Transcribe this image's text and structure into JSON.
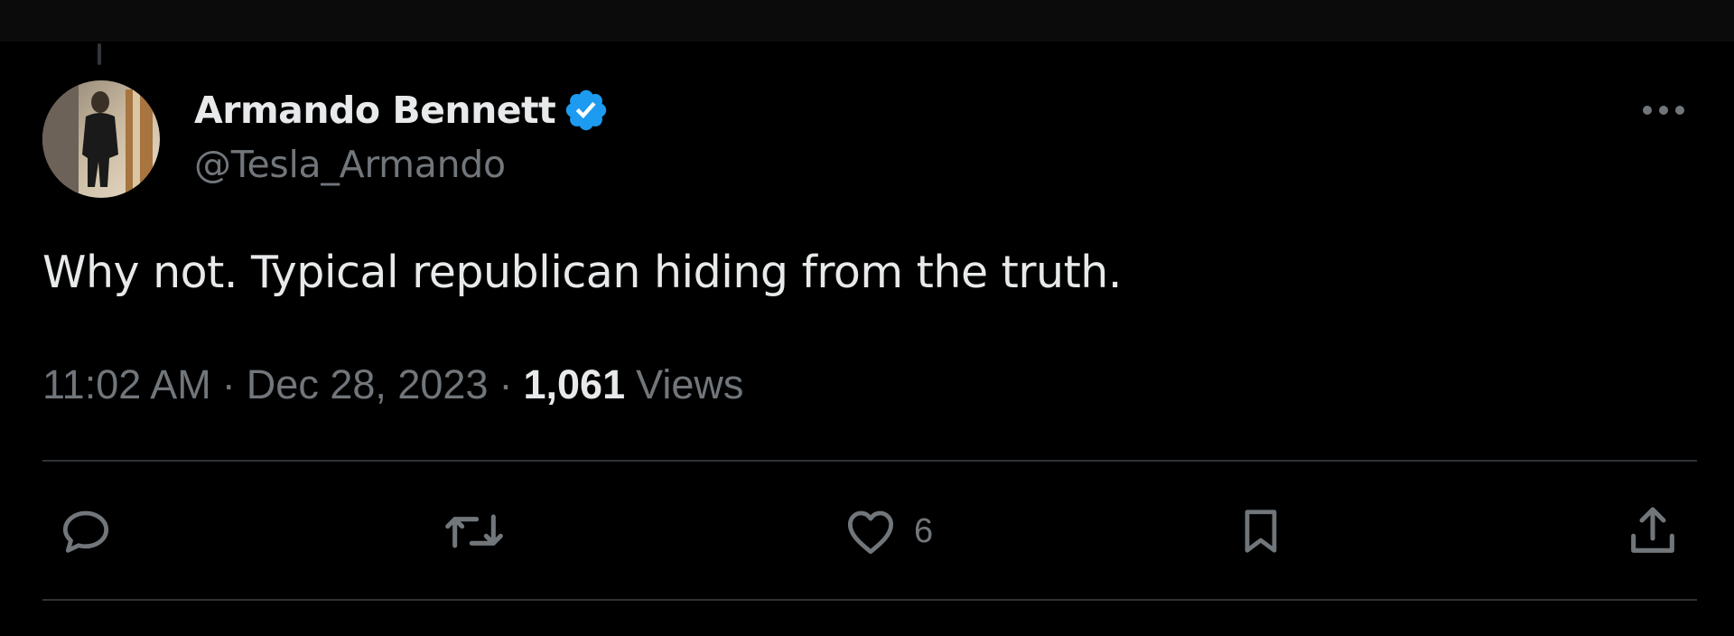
{
  "author": {
    "display_name": "Armando Bennett",
    "handle": "@Tesla_Armando",
    "verified": true
  },
  "tweet": {
    "text": "Why not. Typical republican hiding from the truth."
  },
  "meta": {
    "time": "11:02 AM",
    "separator": "·",
    "date": "Dec 28, 2023",
    "views_count": "1,061",
    "views_label": "Views"
  },
  "actions": {
    "reply_icon": "reply-icon",
    "retweet_icon": "retweet-icon",
    "like_icon": "heart-icon",
    "like_count": "6",
    "bookmark_icon": "bookmark-icon",
    "share_icon": "share-icon"
  },
  "colors": {
    "background": "#000000",
    "primary_text": "#e7e9ea",
    "secondary_text": "#71767b",
    "verified_blue": "#1d9bf0",
    "divider": "#2f3336"
  }
}
